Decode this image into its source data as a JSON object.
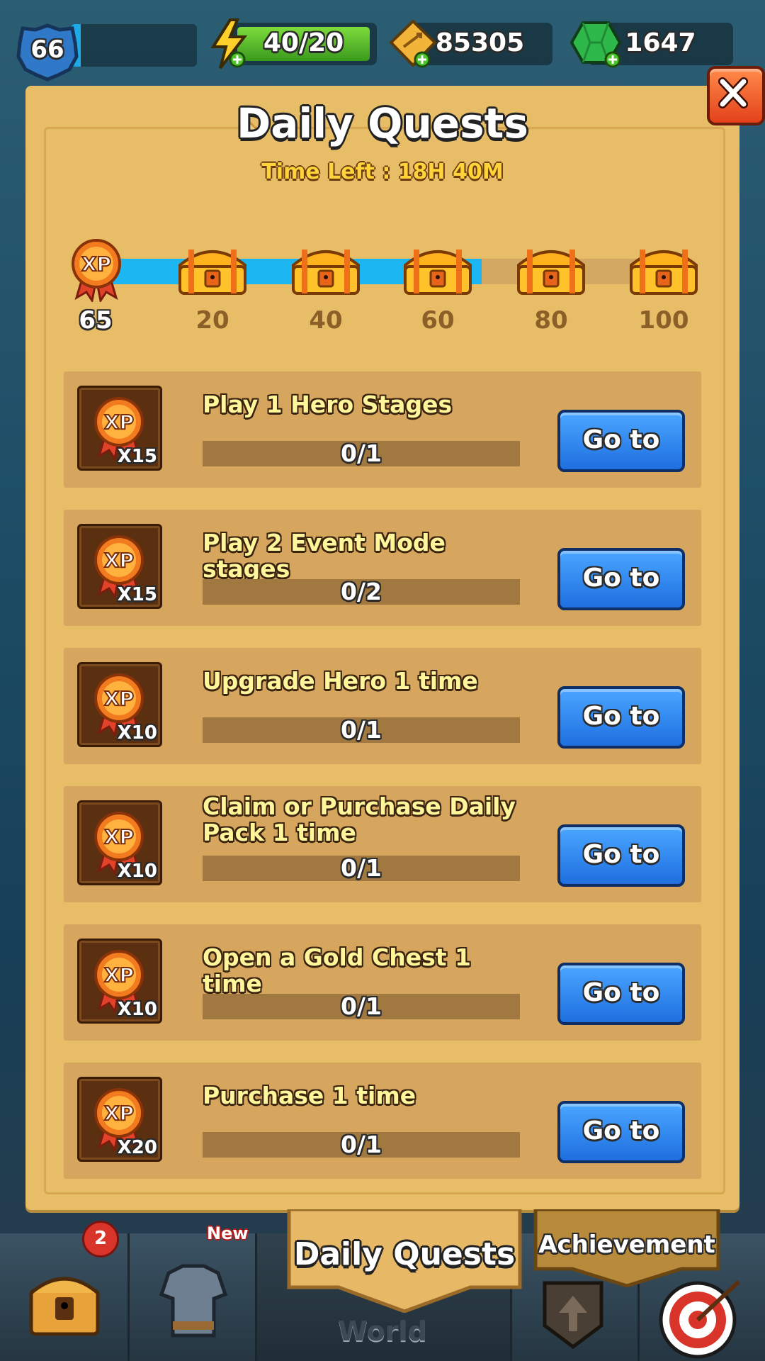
{
  "top_bar": {
    "level": "66",
    "energy": "40/20",
    "gold": "85305",
    "gems": "1647"
  },
  "panel": {
    "title": "Daily Quests",
    "time_left": "Time Left : 18H 40M",
    "close_icon": "close-icon"
  },
  "progress": {
    "current": "65",
    "current_value": 65,
    "max_value": 100,
    "milestones": [
      "20",
      "40",
      "60",
      "80",
      "100"
    ]
  },
  "quests": [
    {
      "label": "Play 1 Hero Stages",
      "reward": "X15",
      "progress": "0/1",
      "button": "Go to"
    },
    {
      "label": "Play 2 Event Mode stages",
      "reward": "X15",
      "progress": "0/2",
      "button": "Go to"
    },
    {
      "label": "Upgrade Hero 1 time",
      "reward": "X10",
      "progress": "0/1",
      "button": "Go to"
    },
    {
      "label": "Claim or Purchase Daily Pack 1 time",
      "reward": "X10",
      "progress": "0/1",
      "button": "Go to"
    },
    {
      "label": "Open a Gold Chest 1 time",
      "reward": "X10",
      "progress": "0/1",
      "button": "Go to"
    },
    {
      "label": "Purchase 1 time",
      "reward": "X20",
      "progress": "0/1",
      "button": "Go to"
    }
  ],
  "bottom_nav": {
    "chest_badge": "2",
    "armor_badge": "New",
    "world": "World",
    "daily_quests_tab": "Daily Quests",
    "achievement_tab": "Achievement"
  },
  "colors": {
    "panel": "#e8bd67",
    "progress_fill": "#1cb7f2",
    "button_blue": "#1f6fe0",
    "close_red": "#e2421b"
  }
}
